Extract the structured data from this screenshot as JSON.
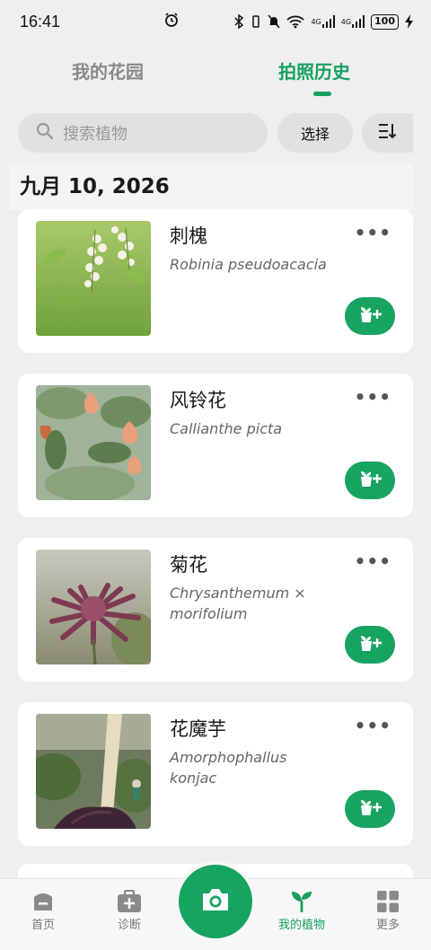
{
  "status_bar": {
    "time": "16:41",
    "signal_4g_1": "4G",
    "signal_4g_2": "4G",
    "battery": "100"
  },
  "tabs": [
    {
      "label": "我的花园",
      "active": false
    },
    {
      "label": "拍照历史",
      "active": true
    }
  ],
  "search": {
    "placeholder": "搜索植物"
  },
  "select_label": "选择",
  "date_header": "九月 10, 2026",
  "plants": [
    {
      "name": "刺槐",
      "scientific": "Robinia pseudoacacia",
      "thumb_icon": "robinia-flowers"
    },
    {
      "name": "风铃花",
      "scientific": "Callianthe picta",
      "thumb_icon": "callianthe-flowers"
    },
    {
      "name": "菊花",
      "scientific": "Chrysanthemum × morifolium",
      "thumb_icon": "chrysanthemum-flower"
    },
    {
      "name": "花魔芋",
      "scientific": "Amorphophallus konjac",
      "thumb_icon": "konjac-plant"
    }
  ],
  "more_label": "•••",
  "bottom_nav": [
    {
      "label": "首页",
      "icon": "home-icon",
      "active": false
    },
    {
      "label": "诊断",
      "icon": "diagnosis-icon",
      "active": false
    },
    {
      "label": "我的植物",
      "icon": "sprout-icon",
      "active": true
    },
    {
      "label": "更多",
      "icon": "grid-icon",
      "active": false
    }
  ],
  "colors": {
    "accent": "#16a05e",
    "inactive": "#777777",
    "background": "#efefef"
  }
}
